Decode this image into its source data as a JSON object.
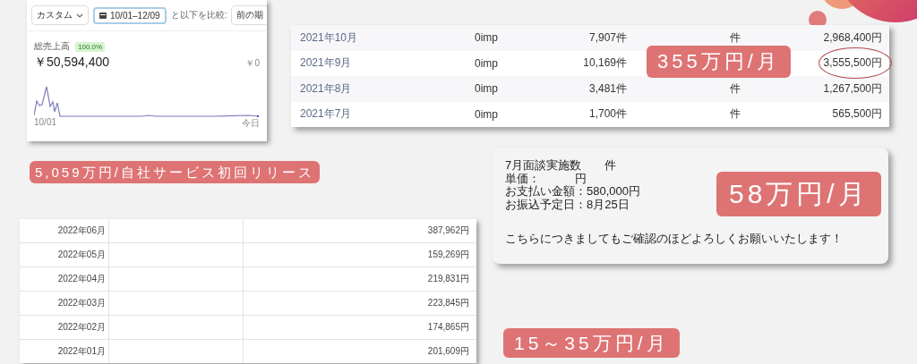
{
  "revenue_panel": {
    "toolbar": {
      "range_dropdown": "カスタム",
      "date_range": "10/01–12/09",
      "compare_label": "と以下を比較:",
      "compare_button": "前の期"
    },
    "metric": {
      "label": "総売上高",
      "badge": "100.0%",
      "value": "￥50,594,400",
      "comparison_value": "￥0",
      "axis_start": "10/01",
      "axis_end": "今日"
    },
    "caption": "5,059万円/自社サービス初回リリース"
  },
  "monthly_table": {
    "rows": [
      {
        "month": "2021年10月",
        "impressions": "0imp",
        "count": "7,907件",
        "column_4": "件",
        "amount": "2,968,400円",
        "circled": false
      },
      {
        "month": "2021年9月",
        "impressions": "0imp",
        "count": "10,169件",
        "amount": "3,555,500円",
        "circled": true
      },
      {
        "month": "2021年8月",
        "impressions": "0imp",
        "count": "3,481件",
        "column_4": "件",
        "amount": "1,267,500円",
        "circled": false
      },
      {
        "month": "2021年7月",
        "impressions": "0imp",
        "count": "1,700件",
        "column_4": "件",
        "amount": "565,500円",
        "circled": false
      }
    ],
    "callout": "355万円/月"
  },
  "payment_note": {
    "lines": [
      "7月面談実施数　　件",
      "単価：　　　円",
      "お支払い金額：580,000円",
      "お振込予定日：8月25日"
    ],
    "message": "こちらにつきましてもご確認のほどよろしくお願いいたします！",
    "callout": "58万円/月"
  },
  "sales_table": {
    "rows": [
      {
        "month": "2022年06月",
        "amount": "387,962円"
      },
      {
        "month": "2022年05月",
        "amount": "159,269円"
      },
      {
        "month": "2022年04月",
        "amount": "219,831円"
      },
      {
        "month": "2022年03月",
        "amount": "223,845円"
      },
      {
        "month": "2022年02月",
        "amount": "174,865円"
      },
      {
        "month": "2022年01月",
        "amount": "201,609円"
      }
    ],
    "callout": "15～35万円/月"
  }
}
